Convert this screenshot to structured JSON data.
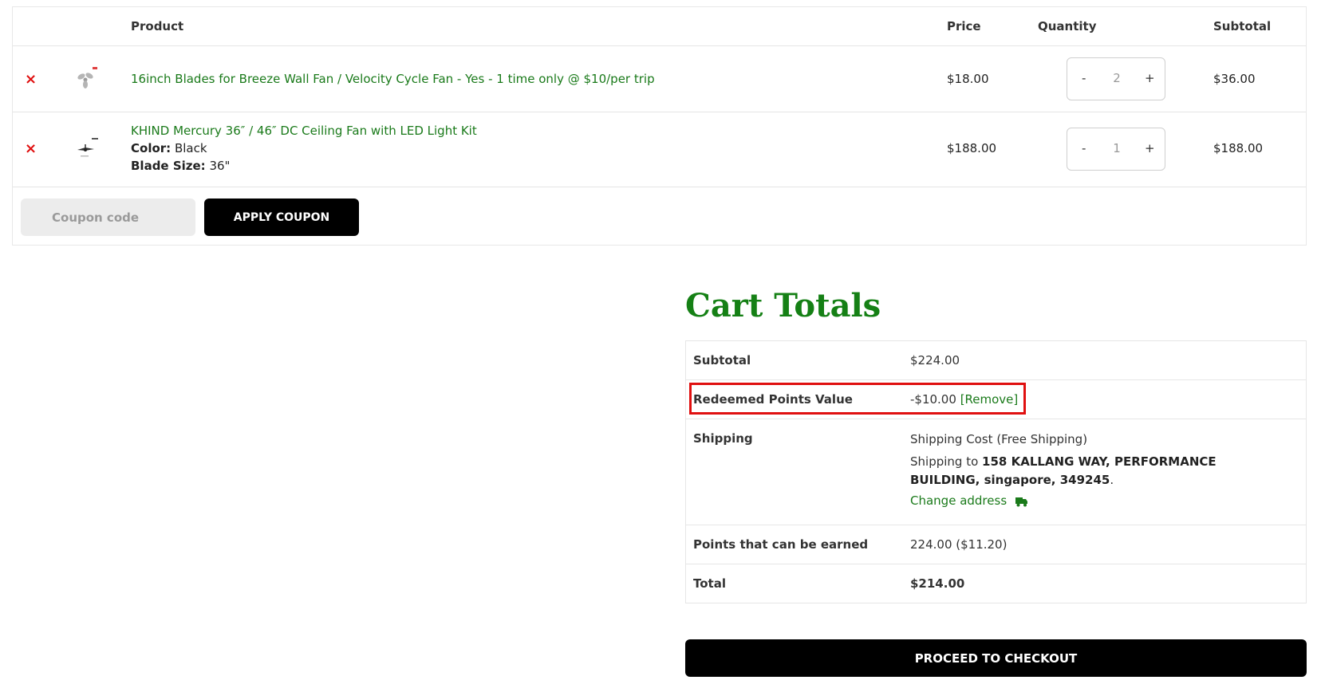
{
  "cart": {
    "headers": {
      "product": "Product",
      "price": "Price",
      "quantity": "Quantity",
      "subtotal": "Subtotal"
    },
    "items": [
      {
        "name": "16inch Blades for Breeze Wall Fan / Velocity Cycle Fan - Yes - 1 time only @ $10/per trip",
        "price": "$18.00",
        "quantity": "2",
        "subtotal": "$36.00"
      },
      {
        "name": "KHIND Mercury 36″ / 46″ DC Ceiling Fan with LED Light Kit",
        "color_label": "Color:",
        "color_value": "Black",
        "blade_label": "Blade Size:",
        "blade_value": "36\"",
        "price": "$188.00",
        "quantity": "1",
        "subtotal": "$188.00"
      }
    ],
    "qty_minus": "-",
    "qty_plus": "+",
    "remove_symbol": "×",
    "coupon_placeholder": "Coupon code",
    "apply_coupon_label": "APPLY COUPON"
  },
  "totals": {
    "title": "Cart Totals",
    "subtotal_label": "Subtotal",
    "subtotal_value": "$224.00",
    "redeemed_label": "Redeemed Points Value",
    "redeemed_value": "-$10.00",
    "redeemed_remove": "[Remove]",
    "shipping_label": "Shipping",
    "shipping_cost": "Shipping Cost (Free Shipping)",
    "shipping_to_prefix": "Shipping to",
    "shipping_address": "158 KALLANG WAY, PERFORMANCE BUILDING, singapore, 349245",
    "shipping_to_suffix": ".",
    "change_address": "Change address",
    "points_label": "Points that can be earned",
    "points_value": "224.00 ($11.20)",
    "total_label": "Total",
    "total_value": "$214.00"
  },
  "checkout_label": "PROCEED TO CHECKOUT",
  "colors": {
    "link_green": "#1a7a1a",
    "title_green": "#158015",
    "remove_red": "#e01010",
    "highlight_red": "#e01010",
    "button_black": "#000000"
  }
}
